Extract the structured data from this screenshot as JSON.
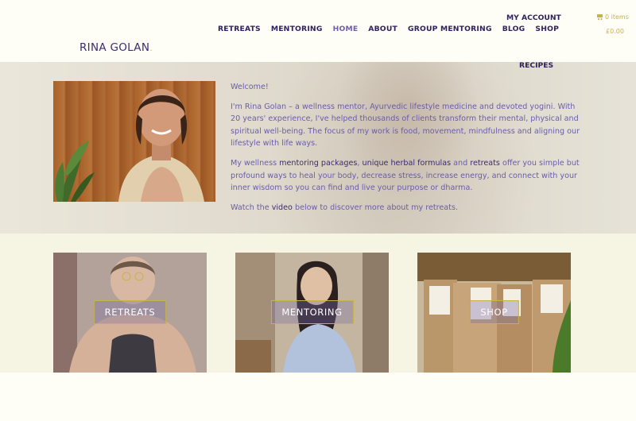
{
  "header": {
    "logo": "RINA GOLAN",
    "logo_dot": ".",
    "nav": [
      "RETREATS",
      "MENTORING",
      "HOME",
      "ABOUT",
      "GROUP MENTORING",
      "BLOG",
      "SHOP"
    ],
    "active_nav": "HOME",
    "my_account": "MY ACCOUNT",
    "recipes": "RECIPES",
    "cart_items": "0 items",
    "cart_total": "£0.00"
  },
  "hero": {
    "welcome": "Welcome!",
    "para1": "I'm Rina Golan – a wellness mentor, Ayurvedic lifestyle medicine and devoted yogini. With 20 years' experience, I've helped thousands of clients transform their mental, physical and spiritual well-being. The focus of my work is food, movement, mindfulness and aligning our lifestyle with life ways.",
    "para2_a": "My wellness ",
    "para2_link1": "mentoring packages",
    "para2_b": ", ",
    "para2_link2": "unique herbal formulas",
    "para2_c": " and ",
    "para2_link3": "retreats",
    "para2_d": " offer you simple but profound ways to heal your body, decrease stress, increase energy, and connect with your inner wisdom so you can find and live your purpose or dharma.",
    "para3_a": "Watch the ",
    "para3_link": "video",
    "para3_b": " below to discover more about my retreats."
  },
  "cards": [
    {
      "label": "RETREATS"
    },
    {
      "label": "MENTORING"
    },
    {
      "label": "SHOP"
    }
  ],
  "colors": {
    "accent_gold": "#c9b24a",
    "brand_purple": "#3d2a72",
    "text_purple": "#6a5cae",
    "cream": "#fefef6"
  }
}
